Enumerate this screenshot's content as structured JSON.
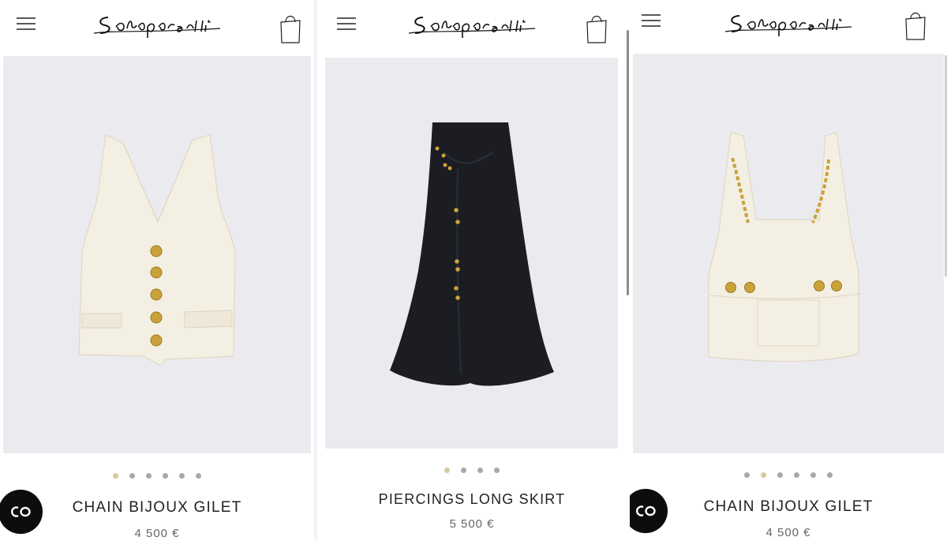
{
  "brand": {
    "logo_text": "Schiaparelli"
  },
  "panels": [
    {
      "product_name": "CHAIN BIJOUX GILET",
      "price": "4 500 €",
      "dots_total": 6,
      "dot_active": 0,
      "garment": "white vest with gold buttons"
    },
    {
      "product_name": "PIERCINGS LONG SKIRT",
      "price": "5 500 €",
      "dots_total": 4,
      "dot_active": 0,
      "garment": "black long skirt with gold piercings"
    },
    {
      "product_name": "CHAIN BIJOUX GILET",
      "price": "4 500 €",
      "dots_total": 6,
      "dot_active": 1,
      "garment": "white top with gold chain straps"
    }
  ],
  "icons": {
    "menu": "hamburger-menu-icon",
    "bag": "shopping-bag-icon",
    "co": "co-chat-icon"
  },
  "colors": {
    "image_background": "#ebebef",
    "active_dot": "#d8c9a5",
    "inactive_dot": "#a8a8ad",
    "co_button": "#0d0d0d",
    "gold": "#c9a23a"
  }
}
